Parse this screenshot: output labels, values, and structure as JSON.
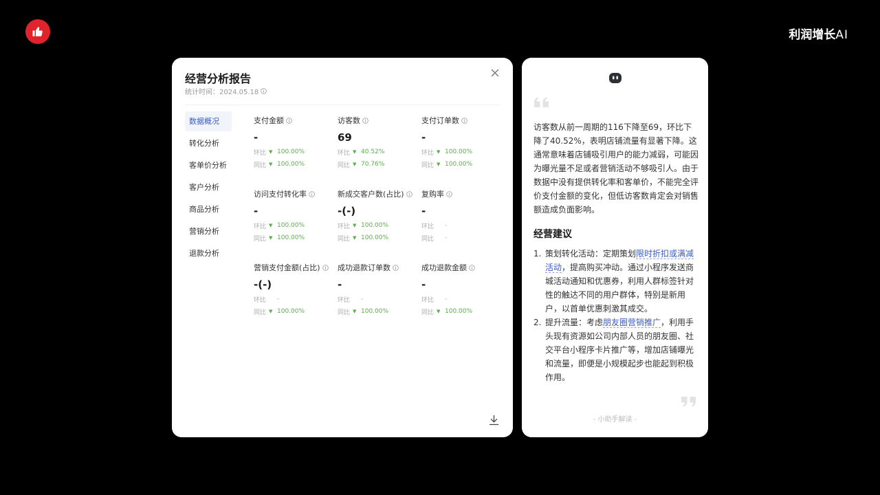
{
  "brand": {
    "name": "利润增长",
    "ai": "AI"
  },
  "report": {
    "title": "经营分析报告",
    "stat_time": "统计时间：2024.05.18",
    "nav": [
      {
        "label": "数据概况"
      },
      {
        "label": "转化分析"
      },
      {
        "label": "客单价分析"
      },
      {
        "label": "客户分析"
      },
      {
        "label": "商品分析"
      },
      {
        "label": "营销分析"
      },
      {
        "label": "退款分析"
      }
    ],
    "metrics": [
      {
        "label": "支付金额",
        "value": "-",
        "huanbi_label": "环比",
        "huanbi": "100.00%",
        "tongbi_label": "同比",
        "tongbi": "100.00%"
      },
      {
        "label": "访客数",
        "value": "69",
        "huanbi_label": "环比",
        "huanbi": "40.52%",
        "tongbi_label": "同比",
        "tongbi": "70.76%"
      },
      {
        "label": "支付订单数",
        "value": "-",
        "huanbi_label": "环比",
        "huanbi": "100.00%",
        "tongbi_label": "同比",
        "tongbi": "100.00%"
      },
      {
        "label": "访问支付转化率",
        "value": "-",
        "huanbi_label": "环比",
        "huanbi": "100.00%",
        "tongbi_label": "同比",
        "tongbi": "100.00%"
      },
      {
        "label": "新成交客户数(占比)",
        "value": "-(-)",
        "huanbi_label": "环比",
        "huanbi": "100.00%",
        "tongbi_label": "同比",
        "tongbi": "100.00%"
      },
      {
        "label": "复购率",
        "value": "-",
        "huanbi_label": "环比",
        "huanbi": "-",
        "tongbi_label": "同比",
        "tongbi": "-"
      },
      {
        "label": "营销支付金额(占比)",
        "value": "-(-)",
        "huanbi_label": "环比",
        "huanbi": "-",
        "tongbi_label": "同比",
        "tongbi": "100.00%"
      },
      {
        "label": "成功退款订单数",
        "value": "-",
        "huanbi_label": "环比",
        "huanbi": "-",
        "tongbi_label": "同比",
        "tongbi": "100.00%"
      },
      {
        "label": "成功退款金额",
        "value": "-",
        "huanbi_label": "环比",
        "huanbi": "-",
        "tongbi_label": "同比",
        "tongbi": "100.00%"
      }
    ]
  },
  "advice": {
    "paragraph": "访客数从前一周期的116下降至69，环比下降了40.52%，表明店铺流量有显著下降。这通常意味着店铺吸引用户的能力减弱，可能因为曝光量不足或者营销活动不够吸引人。由于数据中没有提供转化率和客单价，不能完全评价支付金额的变化，但低访客数肯定会对销售额造成负面影响。",
    "heading": "经营建议",
    "items": [
      {
        "num": "1.",
        "pre": "策划转化活动：定期策划",
        "link": "限时折扣或满减活动",
        "post": "，提高购买冲动。通过小程序发送商城活动通知和优惠券，利用人群标签针对性的触达不同的用户群体，特别是新用户，以首单优惠刺激其成交。"
      },
      {
        "num": "2.",
        "pre": "提升流量：考虑",
        "link": "朋友圈营销推广",
        "post": "，利用手头现有资源如公司内部人员的朋友圈、社交平台小程序卡片推广等，增加店铺曝光和流量，即便是小规模起步也能起到积极作用。"
      }
    ],
    "footer": "- 小助手解读 -"
  },
  "colors": {
    "accent": "#3a5bc7",
    "positive": "#58b146",
    "logo_red": "#e0242d"
  }
}
